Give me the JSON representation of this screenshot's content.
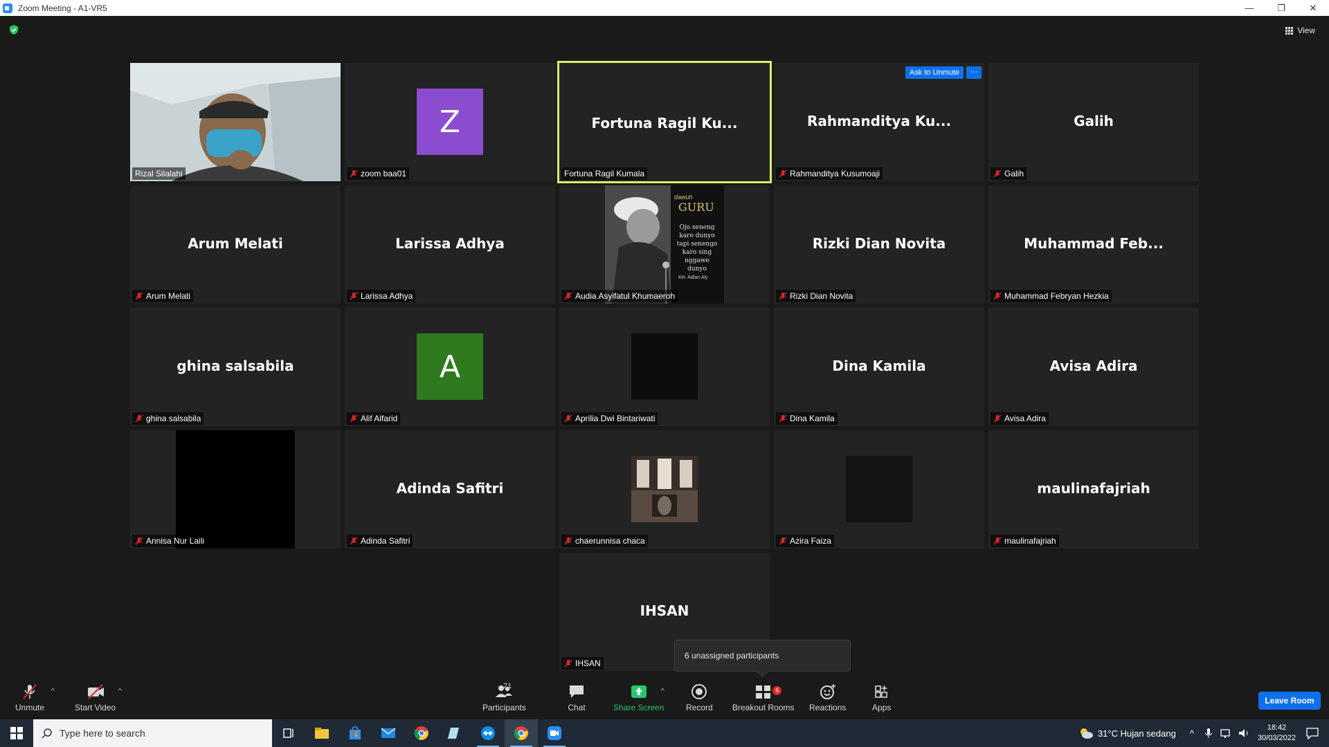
{
  "window": {
    "title": "Zoom Meeting - A1-VR5",
    "controls": [
      "—",
      "❐",
      "✕"
    ]
  },
  "meeting": {
    "view_label": "View",
    "ask_to_unmute": "Ask to Unmute",
    "more": "···",
    "tooltip": "6 unassigned participants",
    "tiles": [
      {
        "big": "",
        "label": "Rizal Silalahi",
        "kind": "video"
      },
      {
        "big": "Z",
        "label": "zoom baa01",
        "kind": "avatar",
        "color": "#8b4ccf"
      },
      {
        "big": "Fortuna  Ragil  Ku...",
        "label": "Fortuna Ragil Kumala",
        "kind": "name",
        "active": true
      },
      {
        "big": "Rahmanditya  Ku...",
        "label": "Rahmanditya Kusumoaji",
        "kind": "name"
      },
      {
        "big": "Galih",
        "label": "Galih",
        "kind": "name"
      },
      {
        "big": "Arum Melati",
        "label": "Arum Melati",
        "kind": "name"
      },
      {
        "big": "Larissa Adhya",
        "label": "Larissa Adhya",
        "kind": "name"
      },
      {
        "big": "",
        "label": "Audia Asyifatul Khumaeroh",
        "kind": "picture"
      },
      {
        "big": "Rizki Dian Novita",
        "label": "Rizki Dian Novita",
        "kind": "name"
      },
      {
        "big": "Muhammad  Feb...",
        "label": "Muhammad Febryan Hezkia",
        "kind": "name"
      },
      {
        "big": "ghina salsabila",
        "label": "ghina salsabila",
        "kind": "name"
      },
      {
        "big": "A",
        "label": "Alif Alfarid",
        "kind": "avatar",
        "color": "#2f7a1f"
      },
      {
        "big": "",
        "label": "Aprilia Dwi Bintariwati",
        "kind": "black"
      },
      {
        "big": "Dina Kamila",
        "label": "Dina Kamila",
        "kind": "name"
      },
      {
        "big": "Avisa Adira",
        "label": "Avisa Adira",
        "kind": "name"
      },
      {
        "big": "",
        "label": "Annisa Nur Laili",
        "kind": "blackwide"
      },
      {
        "big": "Adinda Safitri",
        "label": "Adinda Safitri",
        "kind": "name"
      },
      {
        "big": "",
        "label": "chaerunnisa chaca",
        "kind": "photo"
      },
      {
        "big": "",
        "label": "Azira Faiza",
        "kind": "dark"
      },
      {
        "big": "maulinafajriah",
        "label": "maulinafajriah",
        "kind": "name"
      },
      {
        "big": "IHSAN",
        "label": "IHSAN",
        "kind": "name"
      }
    ],
    "picture_text": {
      "title": "GURU",
      "subtitle": "dawuh",
      "quote": "Ojo seneng karo dunyo tapi senengo karo sing nggawe dunyo",
      "author": "KH. Adlan Aly"
    }
  },
  "toolbar": {
    "unmute": "Unmute",
    "start_video": "Start Video",
    "participants": "Participants",
    "participants_count": "21",
    "chat": "Chat",
    "share_screen": "Share Screen",
    "record": "Record",
    "breakout_rooms": "Breakout Rooms",
    "breakout_badge": "6",
    "reactions": "Reactions",
    "apps": "Apps",
    "leave": "Leave Room"
  },
  "taskbar": {
    "search_placeholder": "Type here to search",
    "weather": "31°C  Hujan sedang",
    "time": "18:42",
    "date": "30/03/2022"
  },
  "colors": {
    "accent": "#0e71eb",
    "active_border": "#ddec6d",
    "share_green": "#28c76f",
    "mute_red": "#e02828"
  }
}
